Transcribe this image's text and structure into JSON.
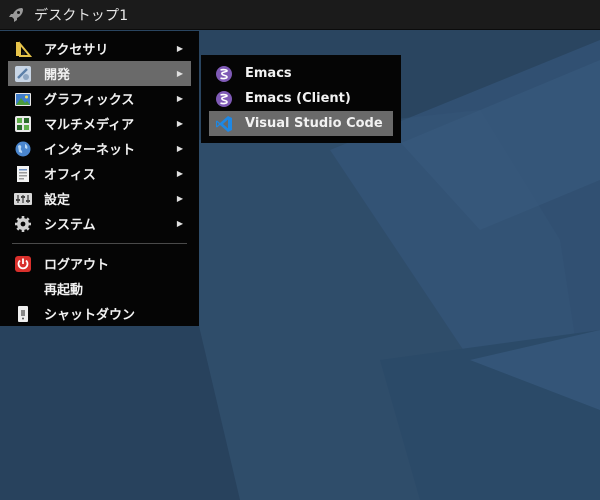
{
  "panel": {
    "title": "デスクトップ1",
    "launcher_icon": "rocket-icon"
  },
  "menu": {
    "items": [
      {
        "label": "アクセサリ",
        "icon": "accessories-icon",
        "has_submenu": true
      },
      {
        "label": "開発",
        "icon": "development-icon",
        "has_submenu": true,
        "active": true
      },
      {
        "label": "グラフィックス",
        "icon": "graphics-icon",
        "has_submenu": true
      },
      {
        "label": "マルチメディア",
        "icon": "multimedia-icon",
        "has_submenu": true
      },
      {
        "label": "インターネット",
        "icon": "internet-icon",
        "has_submenu": true
      },
      {
        "label": "オフィス",
        "icon": "office-icon",
        "has_submenu": true
      },
      {
        "label": "設定",
        "icon": "settings-icon",
        "has_submenu": true
      },
      {
        "label": "システム",
        "icon": "system-icon",
        "has_submenu": true
      }
    ],
    "actions": [
      {
        "label": "ログアウト",
        "icon": "power-icon"
      },
      {
        "label": "再起動",
        "icon": ""
      },
      {
        "label": "シャットダウン",
        "icon": "shutdown-icon"
      }
    ],
    "arrow": "▶"
  },
  "submenu": {
    "items": [
      {
        "label": "Emacs",
        "icon": "emacs-icon"
      },
      {
        "label": "Emacs (Client)",
        "icon": "emacs-icon"
      },
      {
        "label": "Visual Studio Code",
        "icon": "vscode-icon",
        "active": true
      }
    ]
  },
  "colors": {
    "desktop": "#2a4560",
    "menu_bg": "#050505",
    "highlight": "#6a6a6a",
    "emacs": "#7f5ab6",
    "vscode": "#1e88e5",
    "power": "#d9302c"
  }
}
